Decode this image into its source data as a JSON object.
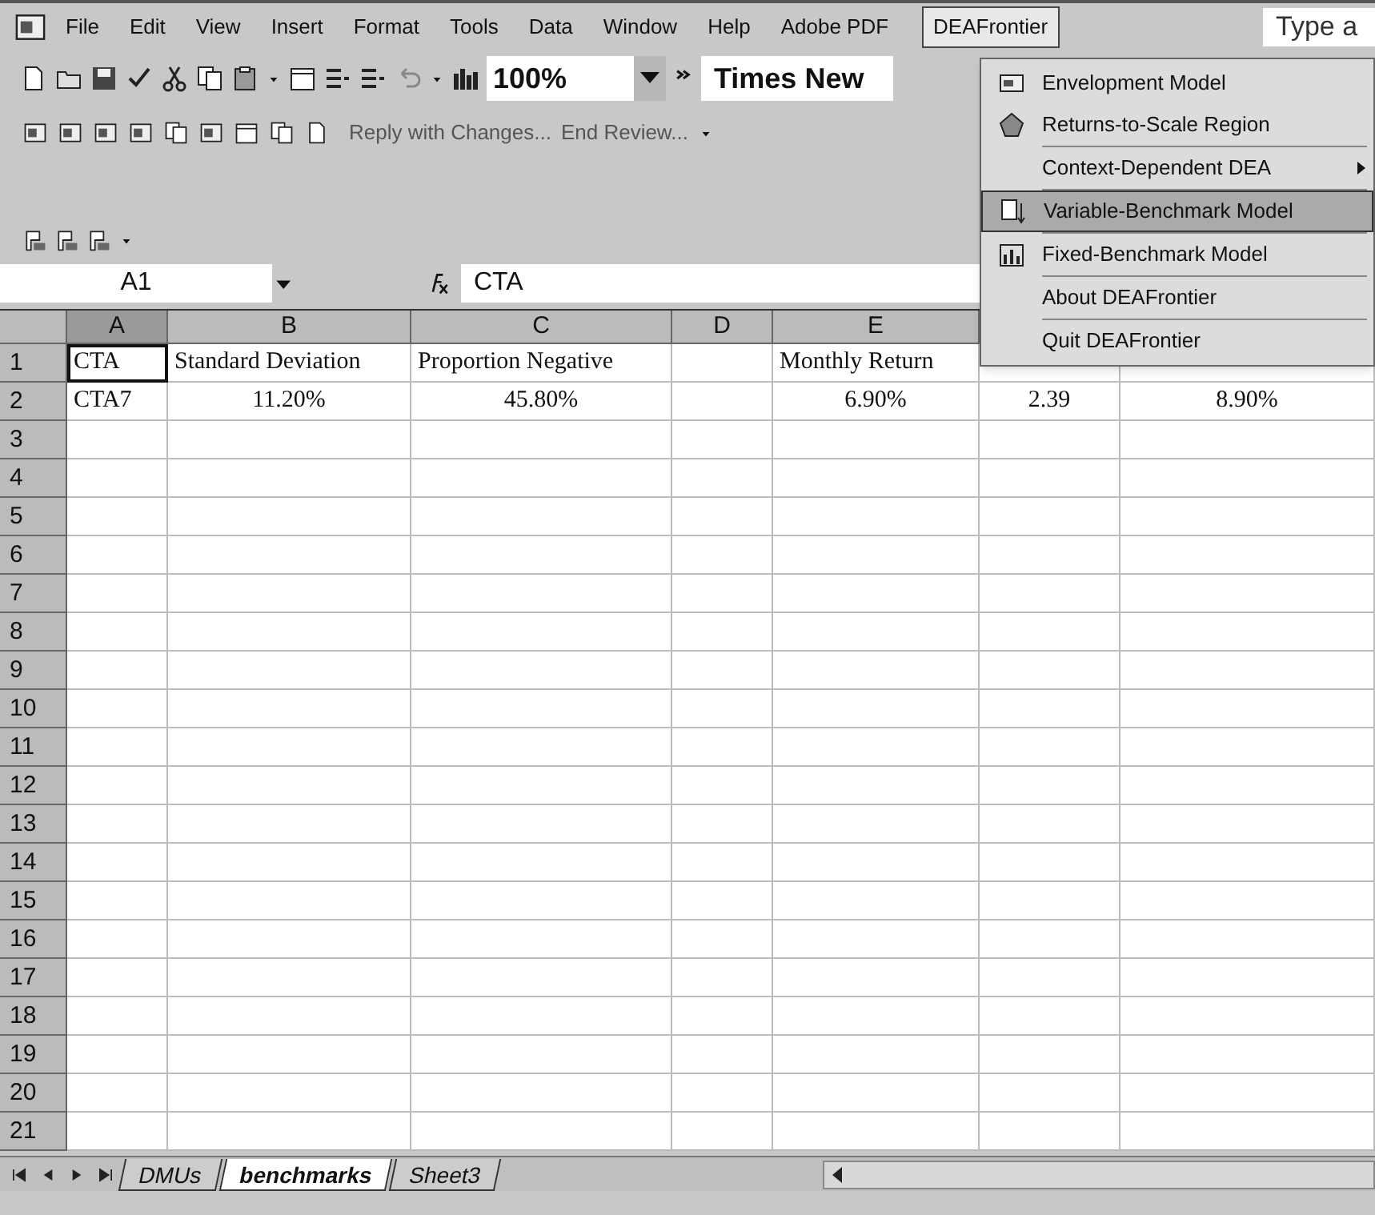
{
  "menu_bar": {
    "items": [
      {
        "label": "File",
        "selected": false
      },
      {
        "label": "Edit",
        "selected": false
      },
      {
        "label": "View",
        "selected": false
      },
      {
        "label": "Insert",
        "selected": false
      },
      {
        "label": "Format",
        "selected": false
      },
      {
        "label": "Tools",
        "selected": false
      },
      {
        "label": "Data",
        "selected": false
      },
      {
        "label": "Window",
        "selected": false
      },
      {
        "label": "Help",
        "selected": false
      },
      {
        "label": "Adobe PDF",
        "selected": false
      },
      {
        "label": "DEAFrontier",
        "selected": true
      }
    ],
    "help_box": "Type a"
  },
  "toolbar": {
    "zoom": "100%",
    "font": "Times New"
  },
  "review_toolbar": {
    "reply": "Reply with Changes...",
    "end": "End Review..."
  },
  "formula_bar": {
    "name_box": "A1",
    "formula": "CTA"
  },
  "sheet": {
    "columns": [
      {
        "label": "A",
        "selected": true
      },
      {
        "label": "B",
        "selected": false
      },
      {
        "label": "C",
        "selected": false
      },
      {
        "label": "D",
        "selected": false
      },
      {
        "label": "E",
        "selected": false
      }
    ],
    "rows": [
      {
        "label": "1",
        "cells": {
          "A": "CTA",
          "B": "Standard Deviation",
          "C": "Proportion Negative",
          "E": "Monthly Return"
        }
      },
      {
        "label": "2",
        "cells": {
          "A": "CTA7",
          "B": "11.20%",
          "C": "45.80%",
          "E": "6.90%",
          "F": "2.39",
          "G": "8.90%"
        }
      },
      {
        "label": "3"
      },
      {
        "label": "4"
      },
      {
        "label": "5"
      },
      {
        "label": "6"
      },
      {
        "label": "7"
      },
      {
        "label": "8"
      },
      {
        "label": "9"
      },
      {
        "label": "10"
      },
      {
        "label": "11"
      },
      {
        "label": "12"
      },
      {
        "label": "13"
      },
      {
        "label": "14"
      },
      {
        "label": "15"
      },
      {
        "label": "16"
      },
      {
        "label": "17"
      },
      {
        "label": "18"
      },
      {
        "label": "19"
      },
      {
        "label": "20"
      },
      {
        "label": "21"
      }
    ]
  },
  "menu": {
    "items": [
      {
        "label": "Envelopment Model",
        "kind": "icon",
        "selected": false
      },
      {
        "label": "Returns-to-Scale Region",
        "kind": "icon",
        "selected": false
      },
      {
        "label": "Context-Dependent DEA",
        "kind": "submenu",
        "selected": false
      },
      {
        "label": "Variable-Benchmark Model",
        "kind": "icon",
        "selected": true
      },
      {
        "label": "Fixed-Benchmark Model",
        "kind": "icon",
        "selected": false
      },
      {
        "label": "About DEAFrontier",
        "kind": "plain",
        "selected": false
      },
      {
        "label": "Quit DEAFrontier",
        "kind": "plain",
        "selected": false
      }
    ]
  },
  "sheet_tabs": [
    {
      "label": "DMUs",
      "selected": false
    },
    {
      "label": "benchmarks",
      "selected": true
    },
    {
      "label": "Sheet3",
      "selected": false
    }
  ]
}
